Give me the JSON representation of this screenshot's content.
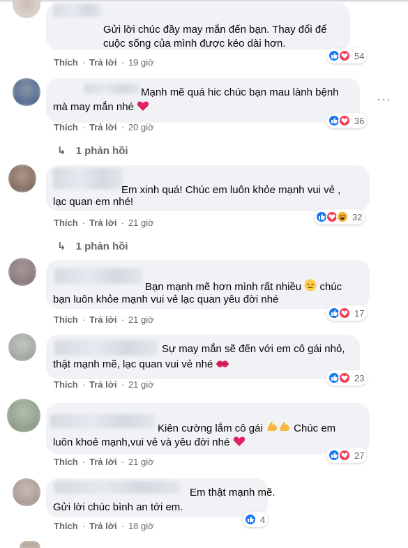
{
  "actions": {
    "like": "Thích",
    "reply": "Trả lời"
  },
  "colors": {
    "like": "#1877f2",
    "love": "#f33e58",
    "haha": "#f7b125",
    "bubble": "#f0f2f5",
    "meta": "#65676b"
  },
  "comments": [
    {
      "line1": "Gửi lời chúc đầy may mắn đến bạn. Thay đổi để",
      "line2": "cuộc sống của mình được kéo dài hơn.",
      "time": "19 giờ",
      "reactions": [
        "like",
        "love"
      ],
      "count": "54"
    },
    {
      "line1": "Mạnh mẽ quá hic chúc bạn mau lành bệnh",
      "line2": "mà may mắn nhé",
      "line2_emoji": "red-heart",
      "time": "20 giờ",
      "reactions": [
        "like",
        "love"
      ],
      "count": "36",
      "replies_label": "1 phản hồi"
    },
    {
      "line1": "Em xinh quá! Chúc em luôn khỏe mạnh vui vẻ ,",
      "line2": "lạc quan em nhé!",
      "time": "21 giờ",
      "reactions": [
        "like",
        "love",
        "haha"
      ],
      "count": "32",
      "replies_label": "1 phản hồi"
    },
    {
      "line1": "Bạn mạnh mẽ hơn mình rất nhiều",
      "line1_emoji": "expressionless-face",
      "line1_tail": "chúc",
      "line2": "bạn luôn khỏe mạnh vui vẻ lạc quan yêu đời nhé",
      "time": "21 giờ",
      "reactions": [
        "like",
        "love"
      ],
      "count": "17"
    },
    {
      "line1": "Sự may mắn sẽ đến với em cô gái nhỏ,",
      "line2": "thật mạnh mẽ, lạc quan vui vẻ nhé",
      "line2_emoji": "kiss-mark",
      "time": "21 giờ",
      "reactions": [
        "like",
        "love"
      ],
      "count": "23"
    },
    {
      "line1": "Kiên cường lắm cô gái",
      "line1_emoji": "flexed-biceps",
      "line1_tail": "Chúc em",
      "line2": "luôn khoẻ mạnh,vui vẻ và yêu đời nhé",
      "line2_emoji": "red-heart",
      "time": "21 giờ",
      "reactions": [
        "like",
        "love"
      ],
      "count": "27"
    },
    {
      "line1": "Em thật mạnh mẽ.",
      "line2": "Gửi lời chúc bình an tới em.",
      "time": "18 giờ",
      "reactions": [
        "like"
      ],
      "count": "4"
    }
  ]
}
